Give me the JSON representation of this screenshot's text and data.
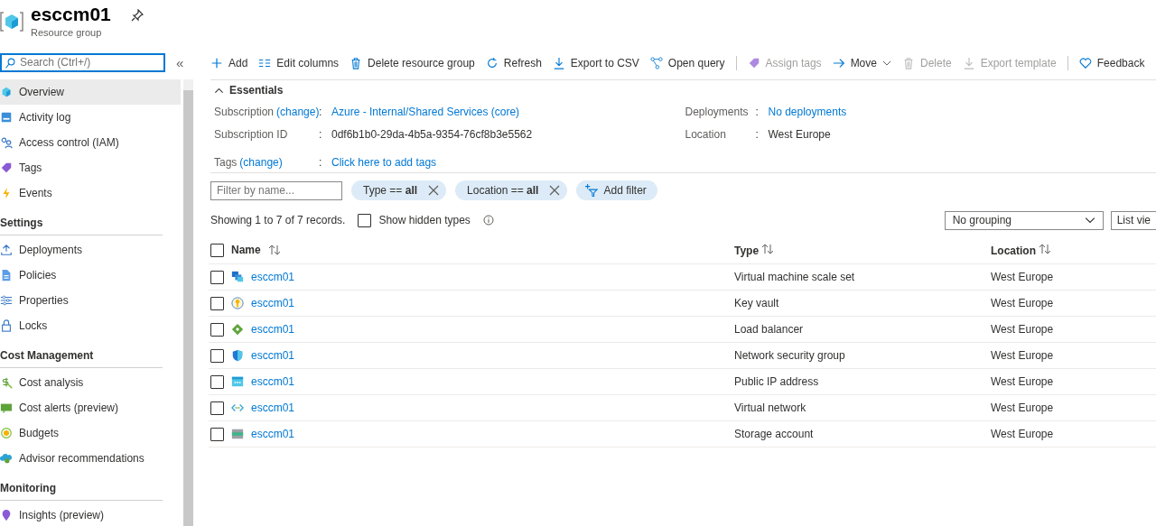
{
  "header": {
    "title": "esccm01",
    "subtitle": "Resource group"
  },
  "sidebar": {
    "search": {
      "placeholder": "Search (Ctrl+/)"
    },
    "collapse": "«",
    "sections": [
      {
        "items": [
          {
            "label": "Overview",
            "kind": "overview",
            "selected": true
          },
          {
            "label": "Activity log",
            "kind": "log",
            "selected": false
          },
          {
            "label": "Access control (IAM)",
            "kind": "iam",
            "selected": false
          },
          {
            "label": "Tags",
            "kind": "tag",
            "selected": false
          },
          {
            "label": "Events",
            "kind": "bolt",
            "selected": false
          }
        ]
      },
      {
        "title": "Settings",
        "items": [
          {
            "label": "Deployments",
            "kind": "upload",
            "selected": false
          },
          {
            "label": "Policies",
            "kind": "doc",
            "selected": false
          },
          {
            "label": "Properties",
            "kind": "sliders",
            "selected": false
          },
          {
            "label": "Locks",
            "kind": "lock",
            "selected": false
          }
        ]
      },
      {
        "title": "Cost Management",
        "items": [
          {
            "label": "Cost analysis",
            "kind": "cost",
            "selected": false
          },
          {
            "label": "Cost alerts (preview)",
            "kind": "alert",
            "selected": false
          },
          {
            "label": "Budgets",
            "kind": "budget",
            "selected": false
          },
          {
            "label": "Advisor recommendations",
            "kind": "cloud",
            "selected": false
          }
        ]
      },
      {
        "title": "Monitoring",
        "items": [
          {
            "label": "Insights (preview)",
            "kind": "pin",
            "selected": false
          }
        ]
      }
    ]
  },
  "toolbar": [
    {
      "label": "Add",
      "kind": "plus",
      "disabled": false
    },
    {
      "label": "Edit columns",
      "kind": "columns",
      "disabled": false
    },
    {
      "label": "Delete resource group",
      "kind": "trash",
      "disabled": false
    },
    {
      "label": "Refresh",
      "kind": "refresh",
      "disabled": false
    },
    {
      "label": "Export to CSV",
      "kind": "download",
      "disabled": false
    },
    {
      "label": "Open query",
      "kind": "query",
      "disabled": false
    },
    {
      "kind": "separator"
    },
    {
      "label": "Assign tags",
      "kind": "tag",
      "disabled": true
    },
    {
      "label": "Move",
      "kind": "arrow",
      "disabled": false,
      "dropdown": true
    },
    {
      "label": "Delete",
      "kind": "trash",
      "disabled": true
    },
    {
      "label": "Export template",
      "kind": "download",
      "disabled": true
    },
    {
      "kind": "separator"
    },
    {
      "label": "Feedback",
      "kind": "heart",
      "disabled": false
    }
  ],
  "essentials": {
    "title": "Essentials",
    "expanded": true,
    "left": [
      {
        "label": "Subscription",
        "change": "(change)",
        "colon": ":",
        "value": "Azure - Internal/Shared Services (core)",
        "link": true
      },
      {
        "label": "Subscription ID",
        "colon": ":",
        "value": "0df6b1b0-29da-4b5a-9354-76cf8b3e5562",
        "link": false
      },
      {
        "label": "Tags",
        "change": "(change)",
        "colon": ":",
        "value": "Click here to add tags",
        "link": true
      }
    ],
    "right": [
      {
        "label": "Deployments",
        "colon": ":",
        "value": "No deployments",
        "link": true
      },
      {
        "label": "Location",
        "colon": ":",
        "value": "West Europe",
        "link": false
      }
    ]
  },
  "filters": {
    "placeholder": "Filter by name...",
    "pills": [
      "Type == **all**",
      "Location == **all**"
    ],
    "add": "Add filter"
  },
  "summary": {
    "text": "Showing 1 to 7 of 7 records.",
    "show_hidden": {
      "label": "Show hidden types",
      "checked": false
    },
    "grouping": "No grouping",
    "view": "List vie"
  },
  "table": {
    "columns": [
      "Name",
      "Type",
      "Location"
    ],
    "all_checked": false,
    "rows": [
      {
        "checked": false,
        "kind": "vmss",
        "name": "esccm01",
        "type": "Virtual machine scale set",
        "location": "West Europe"
      },
      {
        "checked": false,
        "kind": "keyvault",
        "name": "esccm01",
        "type": "Key vault",
        "location": "West Europe"
      },
      {
        "checked": false,
        "kind": "lb",
        "name": "esccm01",
        "type": "Load balancer",
        "location": "West Europe"
      },
      {
        "checked": false,
        "kind": "nsg",
        "name": "esccm01",
        "type": "Network security group",
        "location": "West Europe"
      },
      {
        "checked": false,
        "kind": "pip",
        "name": "esccm01",
        "type": "Public IP address",
        "location": "West Europe"
      },
      {
        "checked": false,
        "kind": "vnet",
        "name": "esccm01",
        "type": "Virtual network",
        "location": "West Europe"
      },
      {
        "checked": false,
        "kind": "storage",
        "name": "esccm01",
        "type": "Storage account",
        "location": "West Europe"
      }
    ]
  }
}
